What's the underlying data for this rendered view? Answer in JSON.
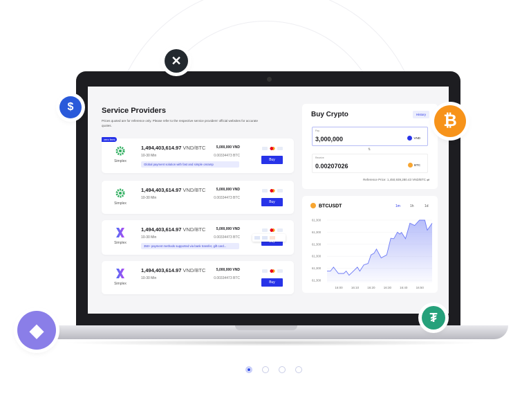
{
  "providers_section": {
    "title": "Service Providers",
    "note": "Prices quoted are for reference only. Please refer to the respective service providers' official websites for accurate quotes.",
    "badge": "zero fees",
    "providers": [
      {
        "name": "Simplex",
        "logo": "green-gear",
        "rate": "1,494,403,614.97",
        "unit": "VND/BTC",
        "time": "10-30 Min",
        "fiat": "5,000,000 VND",
        "crypto": "0.00334473 BTC",
        "desc": "Global payment solution with fast and simple onramp",
        "buy": "Buy"
      },
      {
        "name": "Simplex",
        "logo": "green-gear",
        "rate": "1,494,403,614.97",
        "unit": "VND/BTC",
        "time": "10-30 Min",
        "fiat": "5,000,000 VND",
        "crypto": "0.00334473 BTC",
        "desc": "",
        "buy": "Buy"
      },
      {
        "name": "Simplex",
        "logo": "x",
        "rate": "1,494,403,614.97",
        "unit": "VND/BTC",
        "time": "10-30 Min",
        "fiat": "5,000,000 VND",
        "crypto": "0.00334473 BTC",
        "desc": "350+ payment methods supported via bank transfer, gift card...",
        "buy": "Buy"
      },
      {
        "name": "Simplex",
        "logo": "x",
        "rate": "1,494,403,614.97",
        "unit": "VND/BTC",
        "time": "10-30 Min",
        "fiat": "5,000,000 VND",
        "crypto": "0.00334473 BTC",
        "desc": "",
        "buy": "Buy"
      }
    ]
  },
  "buy_crypto": {
    "title": "Buy Crypto",
    "history": "History",
    "pay_label": "Pay",
    "pay_value": "3,000,000",
    "pay_currency": "VND",
    "receive_label": "Receive",
    "receive_value": "0.00207026",
    "receive_currency": "BTC",
    "swap": "⇅",
    "reference": "Reference Price: 1,450,939,280.43 VND/BTC ⇄"
  },
  "chart_data": {
    "type": "area",
    "title": "BTCUSDT",
    "intervals": [
      "1m",
      "1h",
      "1d"
    ],
    "active_interval": "1m",
    "yticks": [
      "61,300",
      "61,300",
      "61,300",
      "61,300",
      "61,300",
      "61,300"
    ],
    "xticks": [
      "16:00",
      "16:10",
      "16:20",
      "16:30",
      "16:40",
      "16:50"
    ],
    "x_minutes_after_16_00": [
      -7.4,
      -5.3,
      -3.4,
      -0.4,
      2.9,
      4.4,
      6.2,
      11.3,
      12.8,
      15.3,
      17.9,
      19.7,
      21.6,
      23.1,
      26,
      29.4,
      31.9,
      33.8,
      36,
      37.5,
      38.5,
      41,
      43.7,
      46.6,
      49.6,
      52.9,
      54.4,
      57.4
    ],
    "y_relative": [
      15.4,
      15.4,
      21.9,
      11.5,
      11.5,
      15.4,
      8.5,
      21.9,
      15.4,
      25.8,
      28.1,
      42.3,
      45,
      51.9,
      37.3,
      42.3,
      70,
      69.2,
      80,
      76.9,
      79.6,
      69.2,
      95,
      91.2,
      100,
      100,
      83.5,
      95
    ],
    "xlim": [
      -7.4,
      57.4
    ],
    "ylim": [
      0,
      100
    ],
    "color": "#6d7af5"
  },
  "pagination": {
    "pages": 4,
    "current": 1
  }
}
